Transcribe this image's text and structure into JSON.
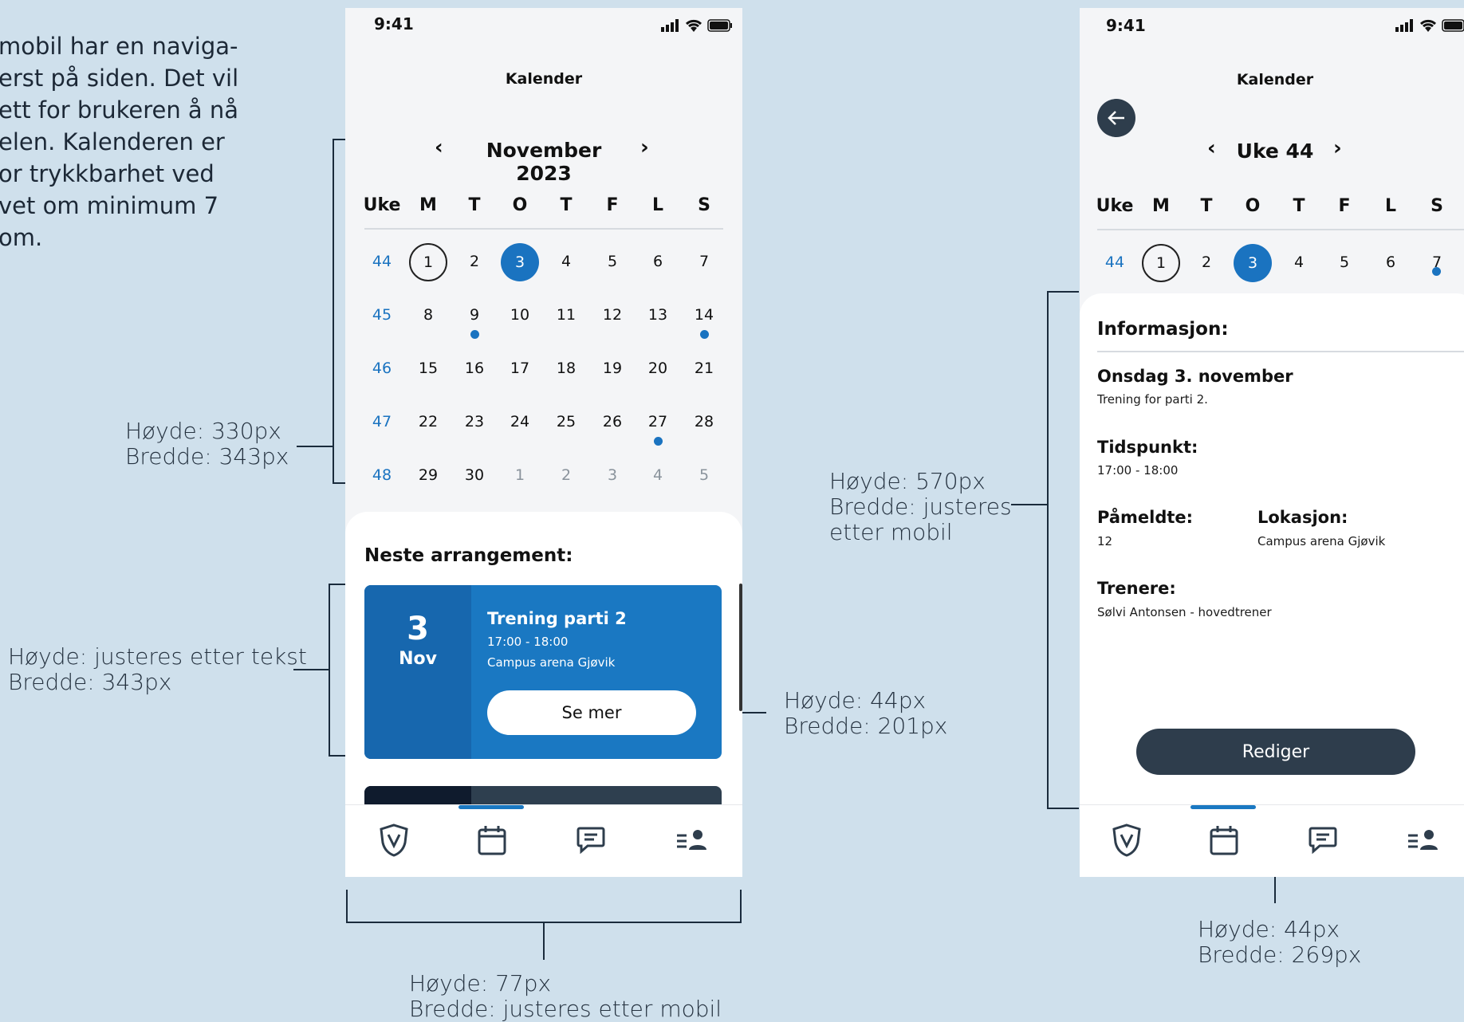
{
  "intro_lines": [
    "mobil har en naviga-",
    "erst på siden. Det vil",
    "ett for brukeren å nå",
    "elen. Kalenderen er",
    "or trykkbarhet ved",
    "vet om minimum 7",
    "om."
  ],
  "annotations": {
    "calendar": [
      "Høyde: 330px",
      "Bredde: 343px"
    ],
    "event_card": [
      "Høyde: justeres etter tekst",
      "Bredde: 343px"
    ],
    "see_more": [
      "Høyde: 44px",
      "Bredde: 201px"
    ],
    "tabbar": [
      "Høyde: 77px",
      "Bredde: justeres etter mobil"
    ],
    "info_sheet": [
      "Høyde: 570px",
      "Bredde: justeres",
      "etter mobil"
    ],
    "edit_button": [
      "Høyde: 44px",
      "Bredde: 269px"
    ]
  },
  "colors": {
    "accent": "#1a73c0",
    "dark_button": "#2e3d4c",
    "background": "#cfe0ec"
  },
  "phone1": {
    "status_time": "9:41",
    "title": "Kalender",
    "prev_icon": "chevron-left-icon",
    "next_icon": "chevron-right-icon",
    "prev_label": "‹",
    "next_label": "›",
    "month": "November 2023",
    "weekday_headers": [
      "Uke",
      "M",
      "T",
      "O",
      "T",
      "F",
      "L",
      "S"
    ],
    "weeks": [
      {
        "week": "44",
        "days": [
          "1",
          "2",
          "3",
          "4",
          "5",
          "6",
          "7"
        ]
      },
      {
        "week": "45",
        "days": [
          "8",
          "9",
          "10",
          "11",
          "12",
          "13",
          "14"
        ]
      },
      {
        "week": "46",
        "days": [
          "15",
          "16",
          "17",
          "18",
          "19",
          "20",
          "21"
        ]
      },
      {
        "week": "47",
        "days": [
          "22",
          "23",
          "24",
          "25",
          "26",
          "27",
          "28"
        ]
      },
      {
        "week": "48",
        "days": [
          "29",
          "30",
          "1",
          "2",
          "3",
          "4",
          "5"
        ]
      }
    ],
    "next_event_title": "Neste arrangement:",
    "event": {
      "day": "3",
      "month": "Nov",
      "title": "Trening parti 2",
      "time": "17:00 - 18:00",
      "location": "Campus arena Gjøvik",
      "button": "Se mer"
    },
    "tabs": [
      "shield-icon",
      "calendar-icon",
      "chat-icon",
      "profile-list-icon"
    ]
  },
  "phone2": {
    "status_time": "9:41",
    "title": "Kalender",
    "back_icon": "arrow-left-icon",
    "prev_label": "‹",
    "next_label": "›",
    "week_title": "Uke 44",
    "weekday_headers": [
      "Uke",
      "M",
      "T",
      "O",
      "T",
      "F",
      "L",
      "S"
    ],
    "week_row": {
      "week": "44",
      "days": [
        "1",
        "2",
        "3",
        "4",
        "5",
        "6",
        "7"
      ]
    },
    "info_title": "Informasjon:",
    "date_title": "Onsdag 3. november",
    "date_desc": "Trening for parti 2.",
    "time_label": "Tidspunkt:",
    "time_value": "17:00 - 18:00",
    "attendees_label": "Påmeldte:",
    "attendees_value": "12",
    "location_label": "Lokasjon:",
    "location_value": "Campus arena Gjøvik",
    "trainers_label": "Trenere:",
    "trainers_value": "Sølvi Antonsen - hovedtrener",
    "edit_button": "Rediger",
    "tabs": [
      "shield-icon",
      "calendar-icon",
      "chat-icon",
      "profile-list-icon"
    ]
  }
}
